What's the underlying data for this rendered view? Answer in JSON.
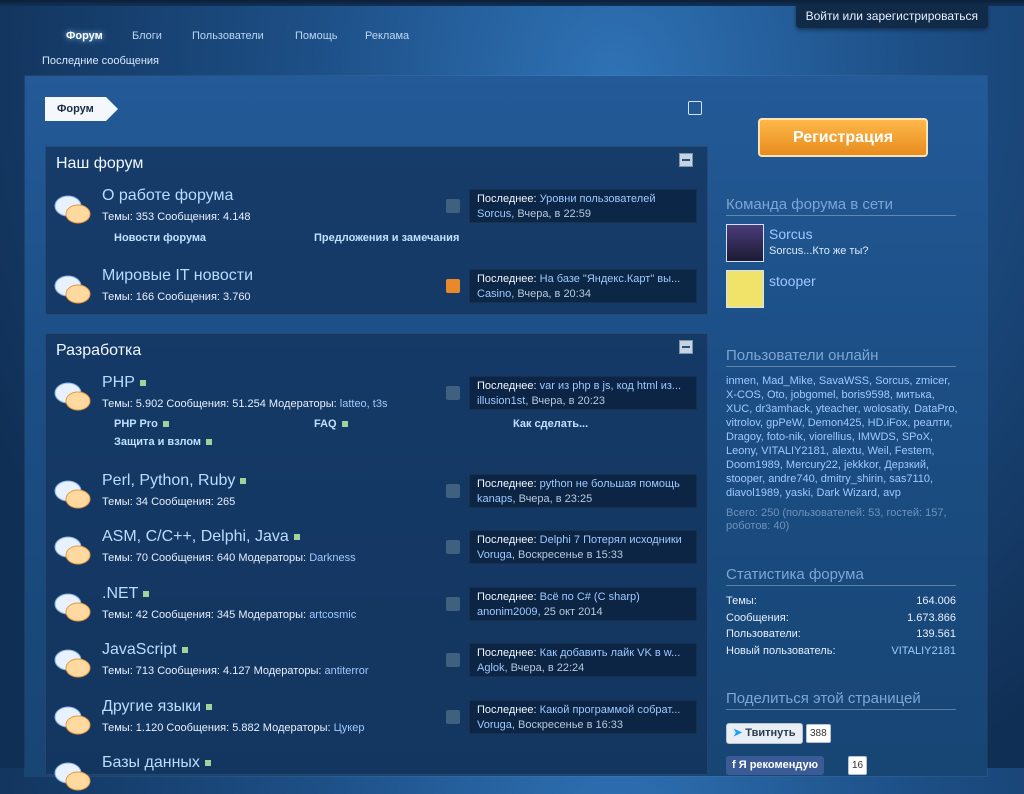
{
  "header": {
    "login": "Войти или зарегистрироваться",
    "nav": [
      "Форум",
      "Блоги",
      "Пользователи",
      "Помощь",
      "Реклама"
    ],
    "active_nav": "Форум",
    "subnav": "Последние сообщения"
  },
  "breadcrumb": "Форум",
  "sections": [
    {
      "title": "Наш форум",
      "forums": [
        {
          "name": "О работе форума",
          "stats": "Темы: 353 Сообщения: 4.148",
          "last": {
            "label": "Последнее:",
            "title": "Уровни пользователей",
            "user": "Sorcus",
            "date": "Вчера, в 22:59"
          },
          "subforums": [
            "Новости форума",
            "Предложения и замечания"
          ]
        },
        {
          "name": "Мировые IT новости",
          "stats": "Темы: 166 Сообщения: 3.760",
          "last": {
            "label": "Последнее:",
            "title": "На базе \"Яндекс.Карт\" вы...",
            "user": "Casino",
            "date": "Вчера, в 20:34"
          }
        }
      ]
    },
    {
      "title": "Разработка",
      "forums": [
        {
          "name": "PHP",
          "stats": "Темы: 5.902 Сообщения: 51.254 Модераторы:",
          "mods": "latteo, t3s",
          "last": {
            "label": "Последнее:",
            "title": "var из php в js, код html из...",
            "user": "illusion1st",
            "date": "Вчера, в 20:23"
          },
          "subforums": [
            "PHP Pro",
            "FAQ",
            "Как сделать...",
            "Защита и взлом"
          ]
        },
        {
          "name": "Perl, Python, Ruby",
          "stats": "Темы: 34 Сообщения: 265",
          "last": {
            "label": "Последнее:",
            "title": "python не большая помощь",
            "user": "kanaps",
            "date": "Вчера, в 23:25"
          }
        },
        {
          "name": "ASM, C/C++, Delphi, Java",
          "stats": "Темы: 70 Сообщения: 640 Модераторы:",
          "mods": "Darkness",
          "last": {
            "label": "Последнее:",
            "title": "Delphi 7 Потерял исходники",
            "user": "Voruga",
            "date": "Воскресенье в 15:33"
          }
        },
        {
          "name": ".NET",
          "stats": "Темы: 42 Сообщения: 345 Модераторы:",
          "mods": "artcosmic",
          "last": {
            "label": "Последнее:",
            "title": "Всё по C# (C sharp)",
            "user": "anonim2009",
            "date": "25 окт 2014"
          }
        },
        {
          "name": "JavaScript",
          "stats": "Темы: 713 Сообщения: 4.127 Модераторы:",
          "mods": "antiterror",
          "last": {
            "label": "Последнее:",
            "title": "Как добавить лайк VK в w...",
            "user": "Aglok",
            "date": "Вчера, в 22:24"
          }
        },
        {
          "name": "Другие языки",
          "stats": "Темы: 1.120 Сообщения: 5.882 Модераторы:",
          "mods": "Цукер",
          "last": {
            "label": "Последнее:",
            "title": "Какой программой собрат...",
            "user": "Voruga",
            "date": "Воскресенье в 16:33"
          }
        },
        {
          "name": "Базы данных"
        }
      ]
    }
  ],
  "sidebar": {
    "register": "Регистрация",
    "team_title": "Команда форума в сети",
    "team": [
      {
        "name": "Sorcus",
        "status": "Sorcus...Кто же ты?"
      },
      {
        "name": "stooper",
        "status": ""
      }
    ],
    "online_title": "Пользователи онлайн",
    "online_list": "inmen, Mad_Mike, SavaWSS, Sorcus, zmicer, X-COS, Oto, jobgomel, boris9598, митька, XUC, dr3amhack, yteacher, wolosatiy, DataPro, vitrolov, gpPeW, Demon425, HD.iFox, реалти, Dragoy, foto-nik, viorellius, IMWDS, SPoX, Leony, VITALIY2181, alextu, Weil, Festem, Doom1989, Mercury22, jekkkor, Дерзкий, stooper, andre740, dmitry_shirin, sas7110, diavol1989, yaski, Dark Wizard, avp",
    "online_total": "Всего: 250 (пользователей: 53, гостей: 157, роботов: 40)",
    "stats_title": "Статистика форума",
    "stats": [
      {
        "label": "Темы:",
        "value": "164.006"
      },
      {
        "label": "Сообщения:",
        "value": "1.673.866"
      },
      {
        "label": "Пользователи:",
        "value": "139.561"
      },
      {
        "label": "Новый пользователь:",
        "value": "VITALIY2181"
      }
    ],
    "share_title": "Поделиться этой страницей",
    "tweet": "Твитнуть",
    "tweet_count": "388",
    "fb": "Я рекомендую",
    "fb_count": "16"
  }
}
